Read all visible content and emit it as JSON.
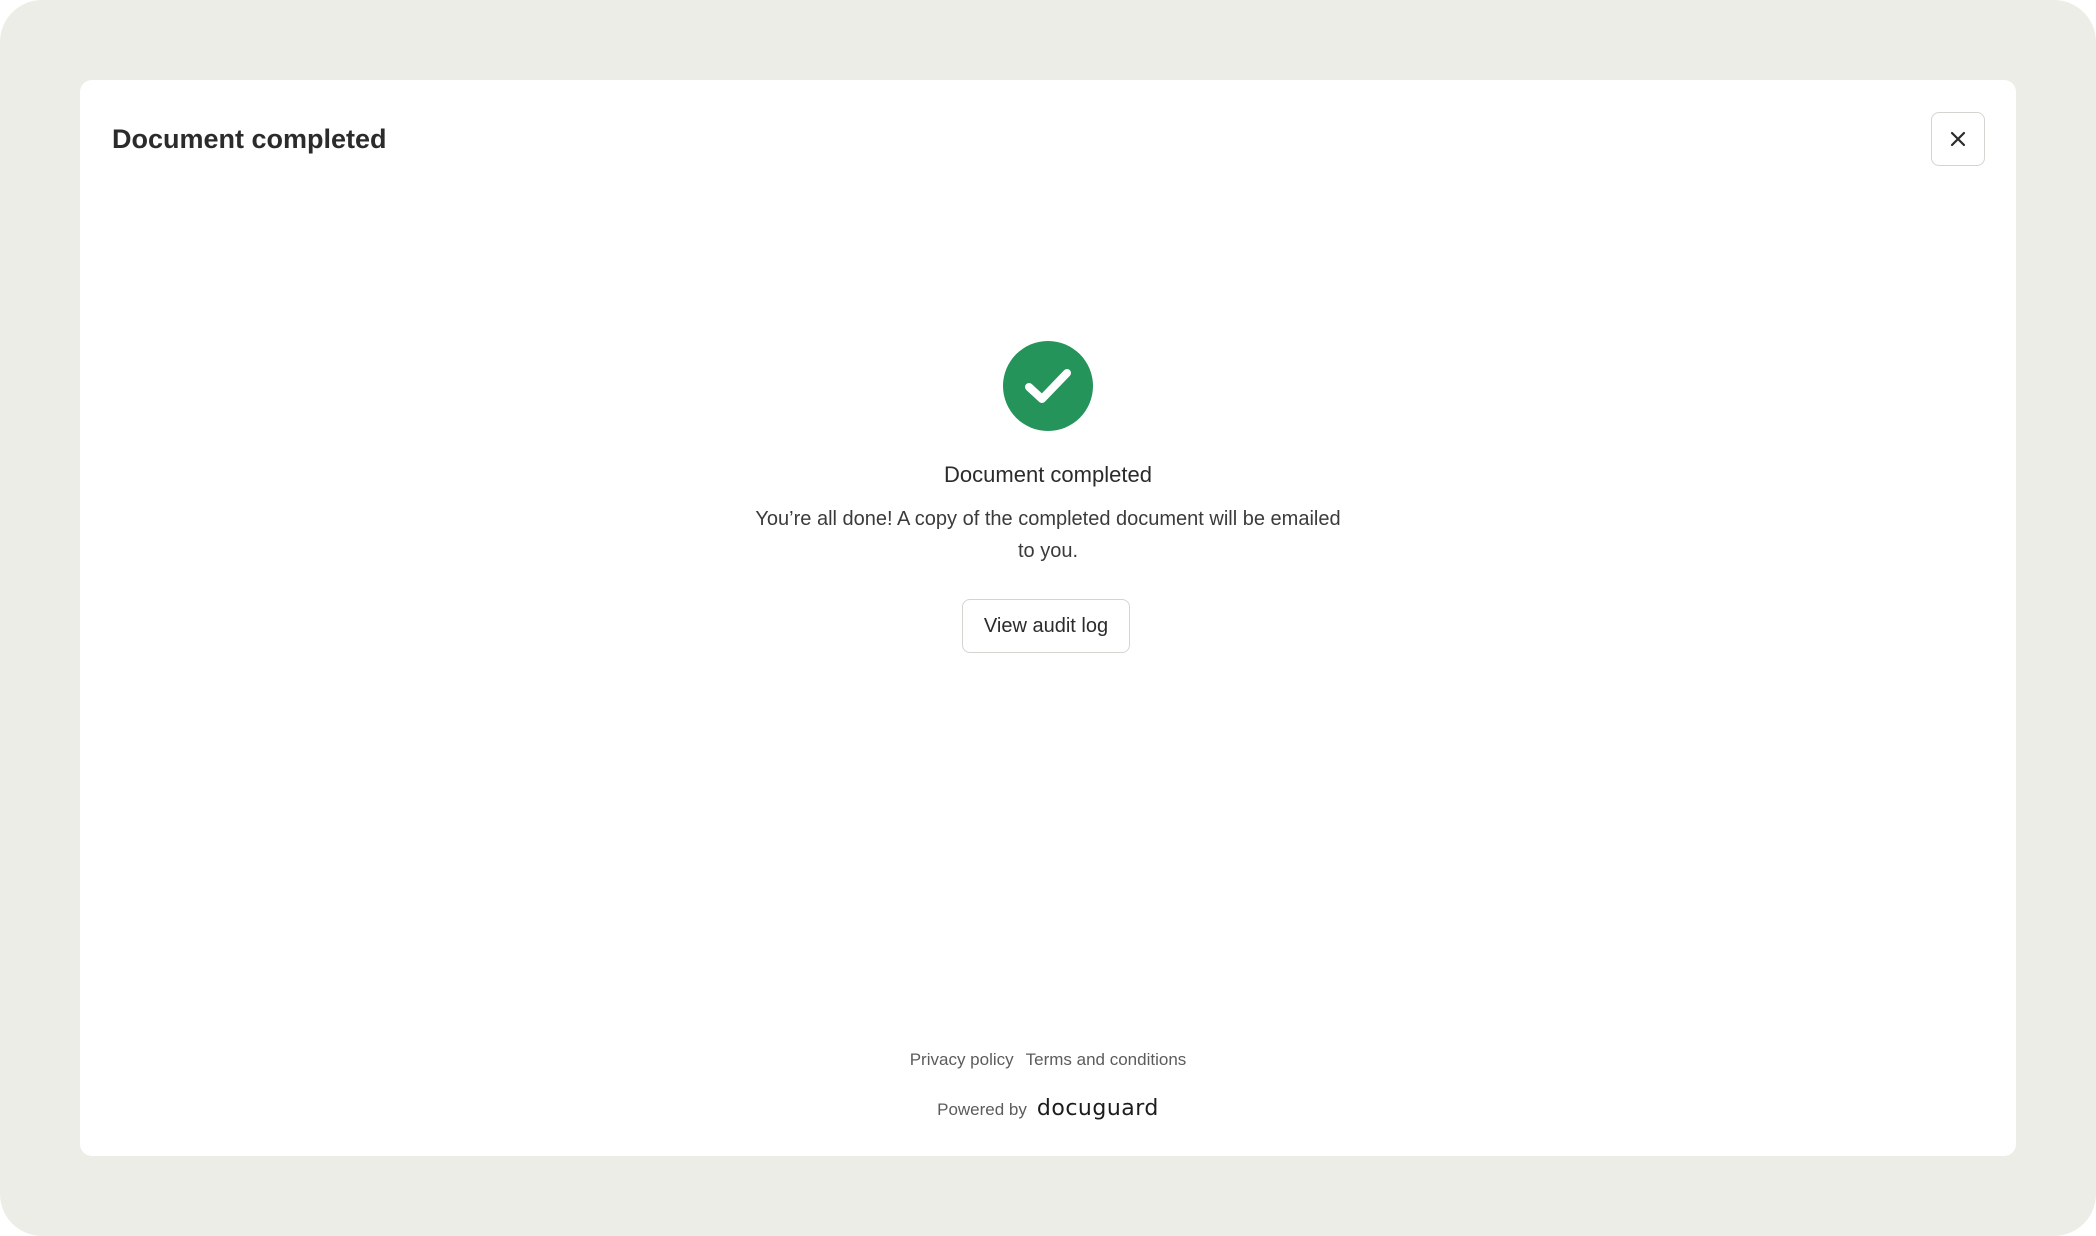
{
  "modal": {
    "title": "Document completed",
    "close_icon": "close-icon"
  },
  "status": {
    "icon": "check-circle-icon",
    "icon_color": "#24945b",
    "title": "Document completed",
    "message": "You’re all done! A copy of the completed document will be emailed to you.",
    "audit_button_label": "View audit log"
  },
  "footer": {
    "privacy_label": "Privacy policy",
    "terms_label": "Terms and conditions",
    "powered_by_label": "Powered by",
    "brand": "docuguard"
  }
}
